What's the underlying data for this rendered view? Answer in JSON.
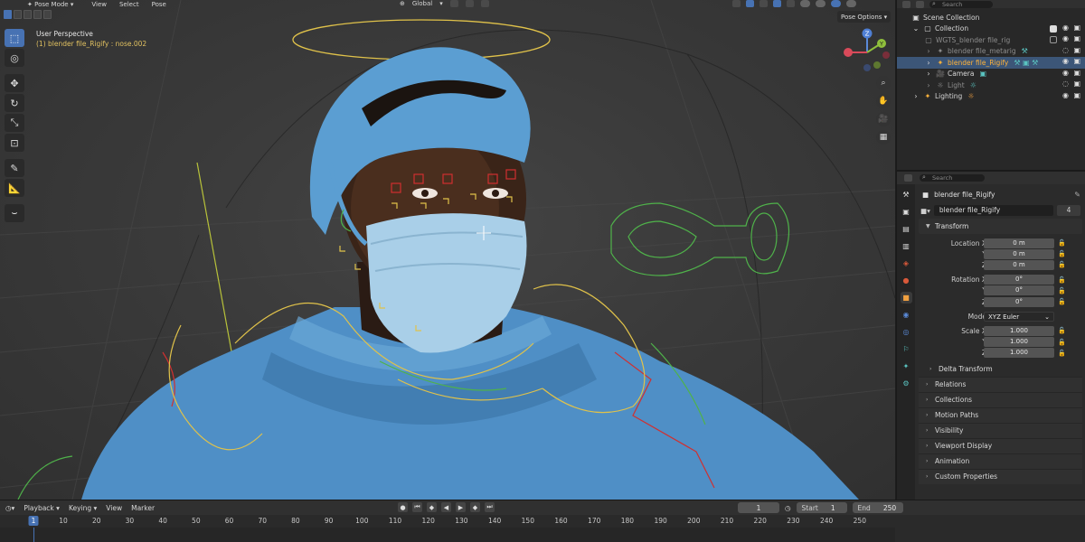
{
  "header": {
    "mode": "Pose Mode",
    "menus": [
      "View",
      "Select",
      "Pose"
    ],
    "orientation": "Global",
    "pose_options": "Pose Options"
  },
  "viewport": {
    "perspective": "User Perspective",
    "active_object": "(1) blender file_Rigify : nose.002"
  },
  "gizmo": {
    "z": "Z",
    "y": "Y",
    "x": "X"
  },
  "outliner": {
    "search_placeholder": "Search",
    "rows": [
      {
        "label": "Scene Collection"
      },
      {
        "label": "Collection"
      },
      {
        "label": "WGTS_blender file_rig"
      },
      {
        "label": "blender file_metarig"
      },
      {
        "label": "blender file_Rigify"
      },
      {
        "label": "Camera"
      },
      {
        "label": "Light"
      },
      {
        "label": "Lighting"
      }
    ]
  },
  "properties": {
    "search_placeholder": "Search",
    "object_name": "blender file_Rigify",
    "data_name": "blender file_Rigify",
    "users": "4",
    "transform_label": "Transform",
    "location": {
      "label": "Location X",
      "x": "0 m",
      "y": "0 m",
      "z": "0 m"
    },
    "rotation": {
      "label": "Rotation X",
      "x": "0°",
      "y": "0°",
      "z": "0°"
    },
    "mode": {
      "label": "Mode",
      "value": "XYZ Euler"
    },
    "scale": {
      "label": "Scale X",
      "x": "1.000",
      "y": "1.000",
      "z": "1.000"
    },
    "axis_y": "Y",
    "axis_z": "Z",
    "delta_transform": "Delta Transform",
    "panels": [
      "Relations",
      "Collections",
      "Motion Paths",
      "Visibility",
      "Viewport Display",
      "Animation",
      "Custom Properties"
    ]
  },
  "timeline": {
    "menus": [
      "Playback",
      "Keying",
      "View",
      "Marker"
    ],
    "current_frame": "1",
    "start_label": "Start",
    "start": "1",
    "end_label": "End",
    "end": "250",
    "ruler_current": "1",
    "ticks": [
      "10",
      "20",
      "30",
      "40",
      "50",
      "60",
      "70",
      "80",
      "90",
      "100",
      "110",
      "120",
      "130",
      "140",
      "150",
      "160",
      "170",
      "180",
      "190",
      "200",
      "210",
      "220",
      "230",
      "240",
      "250"
    ]
  },
  "colors": {
    "accent": "#4772b3",
    "selection": "#3c5678",
    "scrubs": "#4f8fc6",
    "bone_yellow": "#e0c24a",
    "bone_green": "#4fb24a",
    "bone_red": "#d03030"
  }
}
